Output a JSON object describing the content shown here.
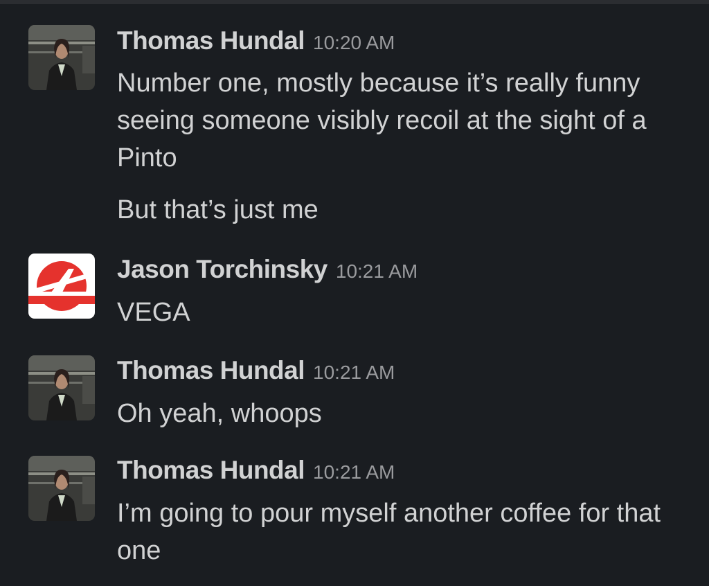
{
  "messages": [
    {
      "author": "Thomas Hundal",
      "time": "10:20 AM",
      "avatar": "profile-photo",
      "paragraphs": [
        "Number one, mostly because it’s really funny seeing someone visibly recoil at the sight of a Pinto",
        "But that’s just me"
      ]
    },
    {
      "author": "Jason Torchinsky",
      "time": "10:21 AM",
      "avatar": "red-logo-icon",
      "paragraphs": [
        "VEGA"
      ]
    },
    {
      "author": "Thomas Hundal",
      "time": "10:21 AM",
      "avatar": "profile-photo",
      "paragraphs": [
        "Oh yeah, whoops"
      ]
    },
    {
      "author": "Thomas Hundal",
      "time": "10:21 AM",
      "avatar": "profile-photo",
      "paragraphs": [
        "I’m going to pour myself another coffee for that one"
      ]
    }
  ],
  "colors": {
    "background": "#1a1d21",
    "text": "#d1d2d3",
    "timestamp": "#9a9b9e",
    "logo_red": "#e5322d"
  }
}
